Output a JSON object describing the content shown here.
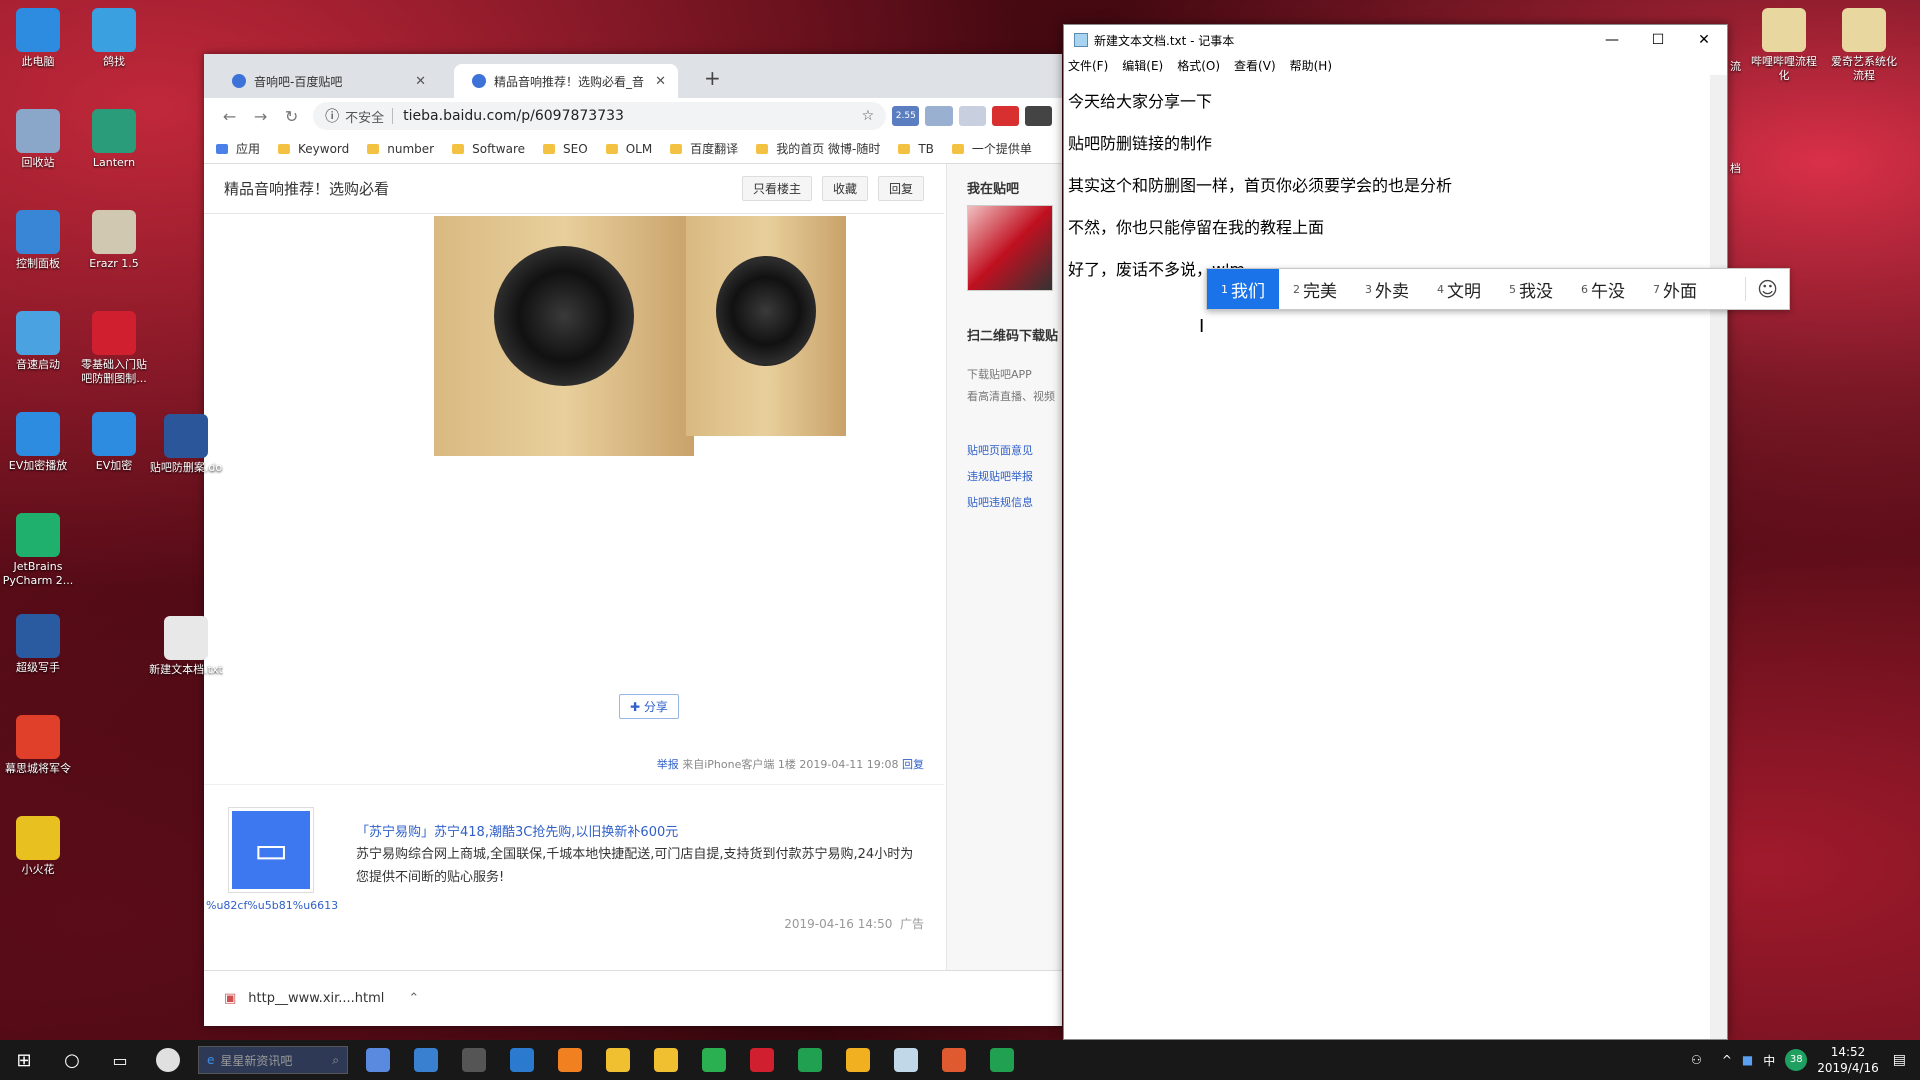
{
  "desktop": {
    "icons_left": [
      {
        "label": "此电脑",
        "color": "#2d8be0"
      },
      {
        "label": "回收站",
        "color": "#8aa6c8"
      },
      {
        "label": "控制面板",
        "color": "#3a86d6"
      },
      {
        "label": "音速启动",
        "color": "#4aa3e0"
      },
      {
        "label": "EV加密播放",
        "color": "#2d8be0"
      },
      {
        "label": "JetBrains PyCharm 2...",
        "color": "#1fb06e"
      },
      {
        "label": "超级写手",
        "color": "#2a5aa0"
      },
      {
        "label": "幕思城将军令",
        "color": "#e0402a"
      },
      {
        "label": "小火花",
        "color": "#e8c020"
      }
    ],
    "icons_col2": [
      {
        "label": "鸽找",
        "color": "#3aa0e0"
      },
      {
        "label": "Lantern",
        "color": "#2a9c7a"
      },
      {
        "label": "Erazr 1.5",
        "color": "#d0c8b0"
      },
      {
        "label": "零基础入门贴吧防删图制...",
        "color": "#d02030"
      },
      {
        "label": "EV加密",
        "color": "#2d8be0"
      }
    ],
    "icons_col3": [
      {
        "label": "贴吧防删案.do",
        "color": "#2b579a"
      },
      {
        "label": "新建文本档.txt",
        "color": "#e8e8e8"
      }
    ],
    "icons_right": [
      {
        "label": "哔哩哔哩流程化",
        "color": "#e8d8a0"
      },
      {
        "label": "爱奇艺系统化流程",
        "color": "#e8d8a0"
      }
    ],
    "right_partial": [
      "流",
      "档"
    ]
  },
  "chrome": {
    "tabs": [
      {
        "label": "音响吧-百度贴吧",
        "active": false
      },
      {
        "label": "精品音响推荐！选购必看_音响吧",
        "active": true
      }
    ],
    "new_tab": "+",
    "address": {
      "insecure_label": "不安全",
      "url": "tieba.baidu.com/p/6097873733"
    },
    "extension_badge": "2.55",
    "bookmarks": [
      "应用",
      "Keyword",
      "number",
      "Software",
      "SEO",
      "OLM",
      "百度翻译",
      "我的首页 微博-随时",
      "TB",
      "一个提供单"
    ],
    "page": {
      "thread_title": "精品音响推荐！选购必看",
      "buttons": [
        "只看楼主",
        "收藏",
        "回复"
      ],
      "share_label": "分享",
      "post_meta": {
        "report": "举报",
        "source": "来自iPhone客户端",
        "floor": "1楼",
        "time": "2019-04-11 19:08",
        "reply": "回复"
      },
      "ad": {
        "username": "%u82cf%u5b81%u6613",
        "title": "「苏宁易购」苏宁418,潮酷3C抢先购,以旧换新补600元",
        "description": "苏宁易购综合网上商城,全国联保,千城本地快捷配送,可门店自提,支持货到付款苏宁易购,24小时为您提供不间断的贴心服务!",
        "time": "2019-04-16 14:50",
        "tag": "广告"
      }
    },
    "sidebar": {
      "heading": "我在贴吧",
      "qr_heading": "扫二维码下载贴",
      "app_lines": [
        "下载贴吧APP",
        "看高清直播、视频"
      ],
      "links": [
        "贴吧页面意见",
        "违规贴吧举报",
        "贴吧违规信息"
      ]
    },
    "download": {
      "filename": "http__www.xir....html"
    }
  },
  "notepad": {
    "title": "新建文本文档.txt - 记事本",
    "menu": [
      "文件(F)",
      "编辑(E)",
      "格式(O)",
      "查看(V)",
      "帮助(H)"
    ],
    "lines": [
      "今天给大家分享一下",
      "贴吧防删链接的制作",
      "其实这个和防删图一样，首页你必须要学会的也是分析",
      "不然，你也只能停留在我的教程上面",
      "好了，废话不多说，w'm"
    ]
  },
  "ime": {
    "candidates": [
      {
        "n": "1",
        "text": "我们",
        "selected": true
      },
      {
        "n": "2",
        "text": "完美",
        "selected": false
      },
      {
        "n": "3",
        "text": "外卖",
        "selected": false
      },
      {
        "n": "4",
        "text": "文明",
        "selected": false
      },
      {
        "n": "5",
        "text": "我没",
        "selected": false
      },
      {
        "n": "6",
        "text": "午没",
        "selected": false
      },
      {
        "n": "7",
        "text": "外面",
        "selected": false
      }
    ]
  },
  "taskbar": {
    "search_placeholder": "星星新资讯吧",
    "tray": {
      "ime_lang": "中",
      "badge": "38",
      "time": "14:52",
      "date": "2019/4/16"
    }
  }
}
